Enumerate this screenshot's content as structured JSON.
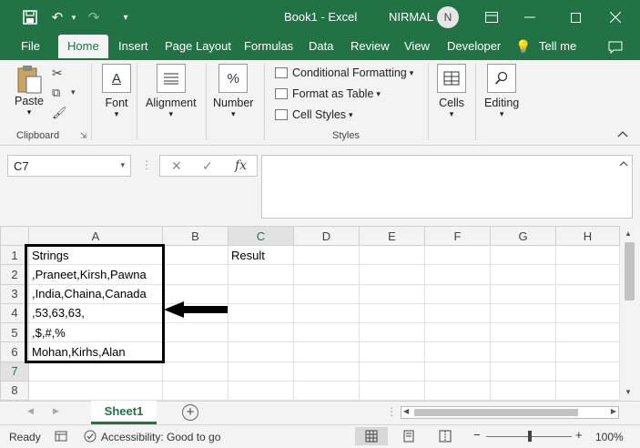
{
  "titlebar": {
    "doc_title": "Book1  -  Excel",
    "user_name": "NIRMAL",
    "avatar_initial": "N"
  },
  "tabs": [
    "File",
    "Home",
    "Insert",
    "Page Layout",
    "Formulas",
    "Data",
    "Review",
    "View",
    "Developer",
    "Tell me"
  ],
  "ribbon": {
    "paste": "Paste",
    "clipboard": "Clipboard",
    "font": "Font",
    "alignment": "Alignment",
    "number": "Number",
    "conditional_formatting": "Conditional Formatting",
    "format_as_table": "Format as Table",
    "cell_styles": "Cell Styles",
    "styles": "Styles",
    "cells": "Cells",
    "editing": "Editing",
    "number_icon": "%",
    "font_icon": "A"
  },
  "formula_bar": {
    "name_box": "C7",
    "fx": "fx",
    "value": ""
  },
  "grid": {
    "columns": [
      "A",
      "B",
      "C",
      "D",
      "E",
      "F",
      "G",
      "H"
    ],
    "rows": [
      {
        "num": "1",
        "cells": [
          "Strings",
          "",
          "Result",
          "",
          "",
          "",
          "",
          ""
        ]
      },
      {
        "num": "2",
        "cells": [
          ",Praneet,Kirsh,Pawna",
          "",
          "",
          "",
          "",
          "",
          "",
          ""
        ]
      },
      {
        "num": "3",
        "cells": [
          ",India,Chaina,Canada",
          "",
          "",
          "",
          "",
          "",
          "",
          ""
        ]
      },
      {
        "num": "4",
        "cells": [
          ",53,63,63,",
          "",
          "",
          "",
          "",
          "",
          "",
          ""
        ]
      },
      {
        "num": "5",
        "cells": [
          ",$,#,%",
          "",
          "",
          "",
          "",
          "",
          "",
          ""
        ]
      },
      {
        "num": "6",
        "cells": [
          "Mohan,Kirhs,Alan",
          "",
          "",
          "",
          "",
          "",
          "",
          ""
        ]
      },
      {
        "num": "7",
        "cells": [
          "",
          "",
          "",
          "",
          "",
          "",
          "",
          ""
        ]
      },
      {
        "num": "8",
        "cells": [
          "",
          "",
          "",
          "",
          "",
          "",
          "",
          ""
        ]
      }
    ]
  },
  "sheets": {
    "active": "Sheet1",
    "add": "+"
  },
  "status": {
    "ready": "Ready",
    "accessibility": "Accessibility: Good to go",
    "zoom": "100%"
  }
}
